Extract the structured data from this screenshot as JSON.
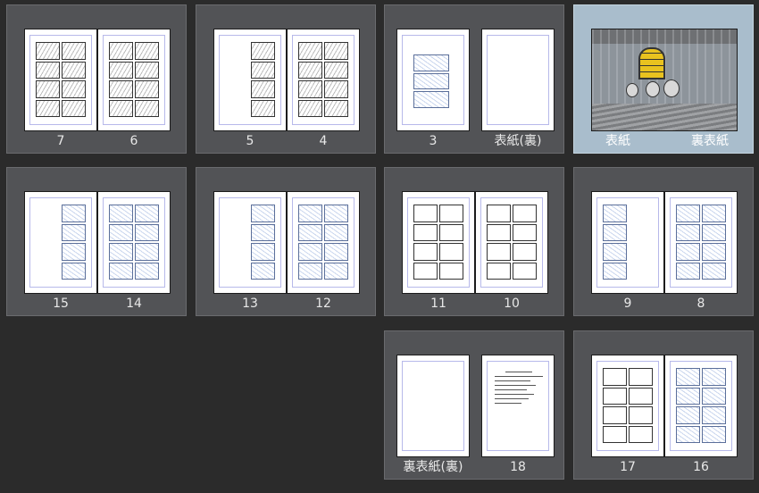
{
  "spreads": [
    {
      "left": "7",
      "right": "6",
      "selected": false
    },
    {
      "left": "5",
      "right": "4",
      "selected": false
    },
    {
      "left": "3",
      "right": "表紙(裏)",
      "selected": false
    },
    {
      "left": "表紙",
      "right": "裏表紙",
      "selected": true
    },
    {
      "left": "15",
      "right": "14",
      "selected": false
    },
    {
      "left": "13",
      "right": "12",
      "selected": false
    },
    {
      "left": "11",
      "right": "10",
      "selected": false
    },
    {
      "left": "9",
      "right": "8",
      "selected": false
    },
    {
      "left": "裏表紙(裏)",
      "right": "18",
      "selected": false
    },
    {
      "left": "17",
      "right": "16",
      "selected": false
    }
  ],
  "colors": {
    "background": "#2b2b2b",
    "spread": "#525356",
    "spread_selected": "#a9bdcc",
    "guide": "#b7b9ea",
    "window_glow": "#e9c21f"
  }
}
